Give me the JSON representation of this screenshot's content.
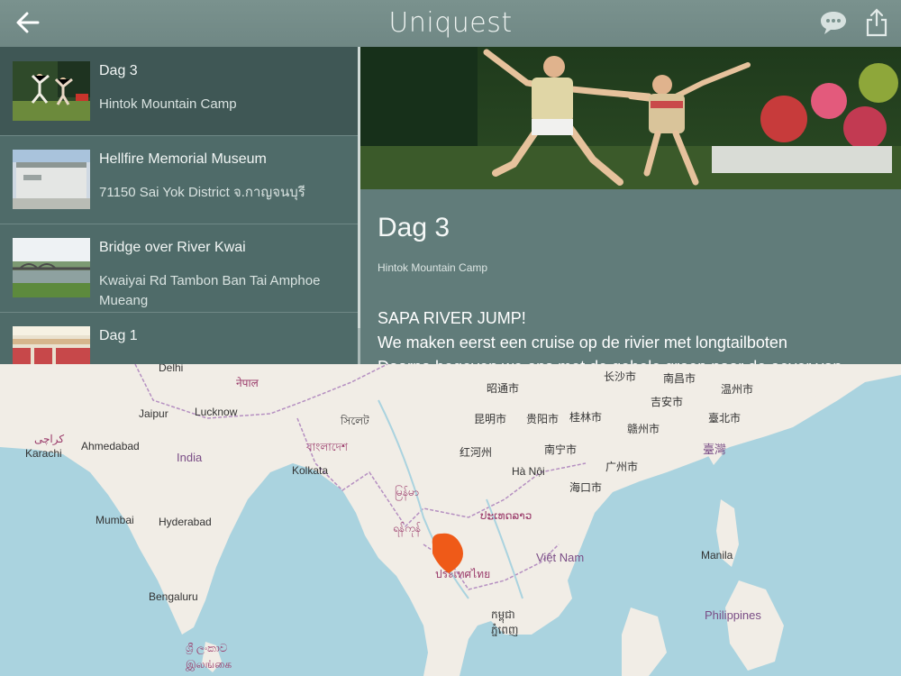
{
  "app": {
    "title": "Uniquest"
  },
  "list": [
    {
      "title": "Dag 3",
      "subtitle": "Hintok Mountain Camp",
      "thumb_icon": "jumping-people-photo"
    },
    {
      "title": "Hellfire Memorial Museum",
      "subtitle": "71150 Sai Yok District จ.กาญจนบุรี",
      "thumb_icon": "museum-building-photo"
    },
    {
      "title": "Bridge over River Kwai",
      "subtitle": "Kwaiyai Rd Tambon Ban Tai Amphoe Mueang",
      "thumb_icon": "bridge-river-photo"
    },
    {
      "title": "Dag 1",
      "subtitle": "",
      "thumb_icon": "aircraft-cabin-photo"
    }
  ],
  "detail": {
    "title": "Dag 3",
    "subtitle": "Hintok Mountain Camp",
    "body_heading": "SAPA RIVER JUMP!",
    "body_line1": "We maken eerst een cruise op de rivier met longtailboten",
    "body_line2": "Daarna begeven we ons met de gehele groep naar de oever van"
  },
  "map": {
    "labels": {
      "delhi": "Delhi",
      "nepal": "नेपाल",
      "jaipur": "Jaipur",
      "lucknow": "Lucknow",
      "sylhet": "সিলেট",
      "karachi_ur": "کراچی",
      "karachi": "Karachi",
      "ahmedabad": "Ahmedabad",
      "india": "India",
      "bangladesh": "বাংলাদেশ",
      "kolkata": "Kolkata",
      "mumbai": "Mumbai",
      "hyderabad": "Hyderabad",
      "bengaluru": "Bengaluru",
      "srilanka_si": "ශ්‍රී ලංකාව",
      "srilanka_ta": "இலங்கை",
      "myanmar": "မြန်မာ",
      "yangon": "ရန်ကုန်",
      "laos": "ປະເທດລາວ",
      "thailand": "ประเทศไทย",
      "vietnam": "Việt Nam",
      "cambodia1": "កម្ពុជា",
      "cambodia2": "ភ្នំពេញ",
      "changsha": "长沙市",
      "nanchang": "南昌市",
      "zhaotong": "昭通市",
      "wenzhou": "温州市",
      "jian": "吉安市",
      "kunming": "昆明市",
      "guiyang": "贵阳市",
      "guilin": "桂林市",
      "ganzhou": "赣州市",
      "taipei": "臺北市",
      "honghe": "红河州",
      "nanning": "南宁市",
      "guangzhou": "广州市",
      "taiwan": "臺灣",
      "hanoi": "Hà Nội",
      "haikou": "海口市",
      "manila": "Manila",
      "philippines": "Philippines"
    },
    "marker_color": "#ef5a18"
  }
}
